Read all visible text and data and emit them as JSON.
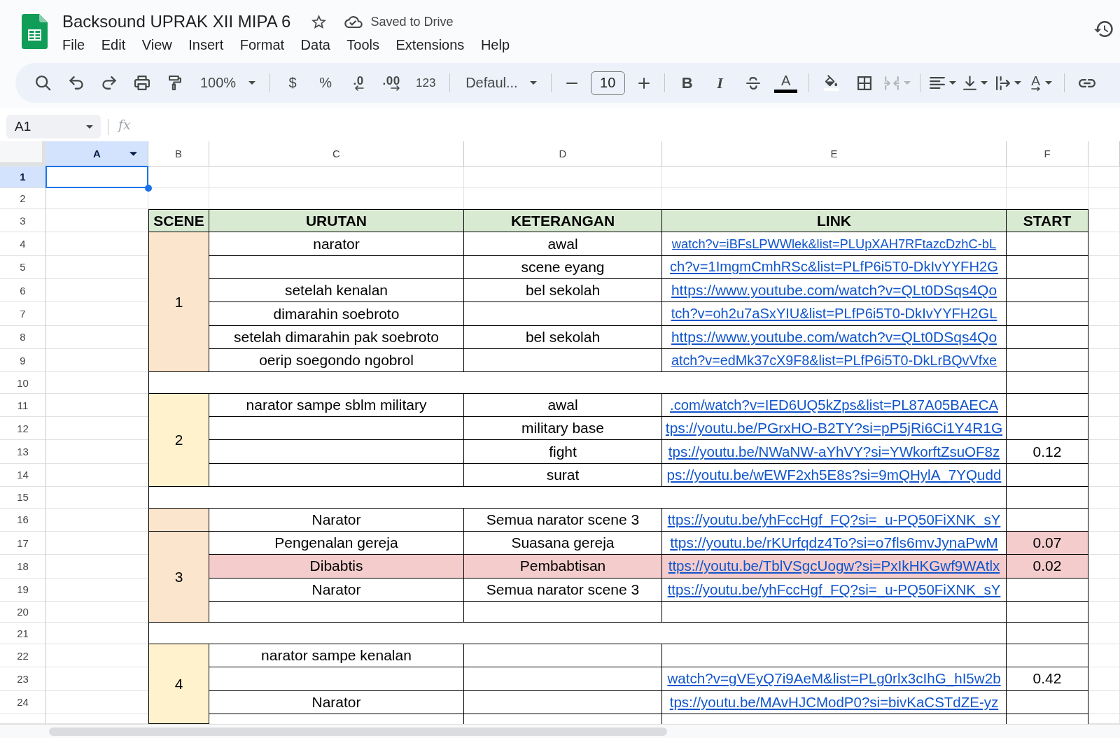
{
  "app": {
    "title": "Backsound UPRAK XII MIPA 6",
    "starred": false,
    "save_status": "Saved to Drive"
  },
  "menu": [
    "File",
    "Edit",
    "View",
    "Insert",
    "Format",
    "Data",
    "Tools",
    "Extensions",
    "Help"
  ],
  "toolbar": [
    [
      {
        "kind": "search",
        "disabled": false
      },
      {
        "kind": "undo",
        "disabled": false
      },
      {
        "kind": "redo",
        "disabled": false
      },
      {
        "kind": "print",
        "disabled": false
      },
      {
        "kind": "paintformat",
        "disabled": false
      },
      {
        "kind": "zoom",
        "label": "100%",
        "disabled": false
      }
    ],
    [
      {
        "kind": "currency",
        "label": "$",
        "disabled": false
      },
      {
        "kind": "percent",
        "label": "%",
        "disabled": false
      },
      {
        "kind": "decimalless",
        "label": ".0",
        "disabled": false
      },
      {
        "kind": "decimalmore",
        "label": ".00",
        "disabled": false
      },
      {
        "kind": "numberformat",
        "label": "123",
        "disabled": false
      }
    ],
    [
      {
        "kind": "font",
        "label": "Defaul...",
        "disabled": false
      }
    ],
    [
      {
        "kind": "sizedown",
        "disabled": false
      },
      {
        "kind": "size",
        "value": "10",
        "disabled": false
      },
      {
        "kind": "sizeup",
        "disabled": false
      }
    ],
    [
      {
        "kind": "bold",
        "label": "B",
        "disabled": false
      },
      {
        "kind": "italic",
        "label": "I",
        "disabled": false
      },
      {
        "kind": "strike",
        "disabled": false
      },
      {
        "kind": "textcolor",
        "label": "A",
        "disabled": false
      }
    ],
    [
      {
        "kind": "fill",
        "disabled": false
      },
      {
        "kind": "borders",
        "disabled": false
      },
      {
        "kind": "merge",
        "disabled": true
      }
    ],
    [
      {
        "kind": "halign",
        "disabled": false
      },
      {
        "kind": "valign",
        "disabled": false
      },
      {
        "kind": "wrap",
        "disabled": false
      },
      {
        "kind": "rotate",
        "label": "A",
        "disabled": false
      }
    ],
    [
      {
        "kind": "link",
        "disabled": false
      }
    ]
  ],
  "formula_bar": {
    "cell": "A1",
    "symbol": "fx"
  },
  "sheet": {
    "columns": [
      {
        "label": "A",
        "selected": true
      },
      {
        "label": "B",
        "selected": false
      },
      {
        "label": "C",
        "selected": false
      },
      {
        "label": "D",
        "selected": false
      },
      {
        "label": "E",
        "selected": false
      },
      {
        "label": "F",
        "selected": false
      }
    ],
    "rows": [
      {
        "label": "1",
        "selected": true
      },
      {
        "label": "2",
        "selected": false
      },
      {
        "label": "3",
        "selected": false
      },
      {
        "label": "4",
        "selected": false
      },
      {
        "label": "5",
        "selected": false
      },
      {
        "label": "6",
        "selected": false
      },
      {
        "label": "7",
        "selected": false
      },
      {
        "label": "8",
        "selected": false
      },
      {
        "label": "9",
        "selected": false
      },
      {
        "label": "10",
        "selected": false
      },
      {
        "label": "11",
        "selected": false
      },
      {
        "label": "12",
        "selected": false
      },
      {
        "label": "13",
        "selected": false
      },
      {
        "label": "14",
        "selected": false
      },
      {
        "label": "15",
        "selected": false
      },
      {
        "label": "16",
        "selected": false
      },
      {
        "label": "17",
        "selected": false
      },
      {
        "label": "18",
        "selected": false
      },
      {
        "label": "19",
        "selected": false
      },
      {
        "label": "20",
        "selected": false
      },
      {
        "label": "21",
        "selected": false
      },
      {
        "label": "22",
        "selected": false
      },
      {
        "label": "23",
        "selected": false
      },
      {
        "label": "24",
        "selected": false
      }
    ],
    "table": {
      "header": [
        "SCENE",
        "URUTAN",
        "KETERANGAN",
        "LINK",
        "START"
      ],
      "blocks": [
        {
          "kind": "group",
          "scene": "1",
          "color": "#fce5cd",
          "rows": [
            {
              "cells": [
                {
                  "text": "narator"
                },
                {
                  "text": "awal"
                },
                {
                  "text": "watch?v=iBFsLPWWlek&list=PLUpXAH7RFtazcDzhC-bL"
                },
                {}
              ]
            },
            {
              "cells": [
                {},
                {
                  "text": "scene eyang"
                },
                {
                  "text": "ch?v=1ImgmCmhRSc&list=PLfP6i5T0-DkIvYYFH2G"
                },
                {}
              ]
            },
            {
              "cells": [
                {
                  "text": "setelah kenalan"
                },
                {
                  "text": "bel sekolah"
                },
                {
                  "text": "https://www.youtube.com/watch?v=QLt0DSqs4Qo"
                },
                {}
              ]
            },
            {
              "cells": [
                {
                  "text": "dimarahin soebroto"
                },
                {},
                {
                  "text": "tch?v=oh2u7aSxYIU&list=PLfP6i5T0-DkIvYYFH2GL"
                },
                {}
              ]
            },
            {
              "cells": [
                {
                  "text": "setelah dimarahin pak soebroto"
                },
                {
                  "text": "bel sekolah"
                },
                {
                  "text": "https://www.youtube.com/watch?v=QLt0DSqs4Qo"
                },
                {}
              ]
            },
            {
              "cells": [
                {
                  "text": "oerip soegondo ngobrol"
                },
                {},
                {
                  "text": "atch?v=edMk37cX9F8&list=PLfP6i5T0-DkLrBQvVfxe"
                },
                {}
              ]
            }
          ]
        },
        {
          "kind": "spacer"
        },
        {
          "kind": "group",
          "scene": "2",
          "color": "#fff2cc",
          "rows": [
            {
              "cells": [
                {
                  "text": "narator sampe sblm military"
                },
                {
                  "text": "awal"
                },
                {
                  "text": ".com/watch?v=IED6UQ5kZps&list=PL87A05BAECA"
                },
                {}
              ]
            },
            {
              "cells": [
                {},
                {
                  "text": "military base"
                },
                {
                  "text": "tps://youtu.be/PGrxHO-B2TY?si=pP5jRi6Ci1Y4R1G"
                },
                {}
              ]
            },
            {
              "cells": [
                {},
                {
                  "text": "fight"
                },
                {
                  "text": "tps://youtu.be/NWaNW-aYhVY?si=YWkorftZsuOF8z"
                },
                {
                  "text": "0.12"
                }
              ]
            },
            {
              "cells": [
                {},
                {
                  "text": "surat"
                },
                {
                  "text": "ps://youtu.be/wEWF2xh5E8s?si=9mQHylA_7YQudd"
                },
                {}
              ]
            }
          ]
        },
        {
          "kind": "spacer"
        },
        {
          "kind": "group",
          "color": "#fce5cd",
          "rows": [
            {
              "cells": [
                {
                  "text": "Narator"
                },
                {
                  "text": "Semua narator scene 3"
                },
                {
                  "text": "ttps://youtu.be/yhFccHgf_FQ?si=_u-PQ50FiXNK_sY"
                },
                {}
              ]
            }
          ]
        },
        {
          "kind": "group",
          "scene": "3",
          "color": "#fce5cd",
          "rows": [
            {
              "cells": [
                {
                  "text": "Pengenalan gereja"
                },
                {
                  "text": "Suasana gereja"
                },
                {
                  "text": "ttps://youtu.be/rKUrfqdz4To?si=o7fls6mvJynaPwM"
                },
                {
                  "text": "0.07",
                  "color": "#f4cccc"
                }
              ]
            },
            {
              "cells": [
                {
                  "text": "Dibabtis",
                  "color": "#f4cccc"
                },
                {
                  "text": "Pembabtisan",
                  "color": "#f4cccc"
                },
                {
                  "text": "ttps://youtu.be/TblVSgcUogw?si=PxIkHKGwf9WAtlx",
                  "color": "#f4cccc"
                },
                {
                  "text": "0.02",
                  "color": "#f4cccc"
                }
              ]
            },
            {
              "cells": [
                {
                  "text": "Narator"
                },
                {
                  "text": "Semua narator scene 3"
                },
                {
                  "text": "ttps://youtu.be/yhFccHgf_FQ?si=_u-PQ50FiXNK_sY"
                },
                {}
              ]
            },
            {
              "cells": [
                {},
                {},
                {},
                {}
              ]
            }
          ]
        },
        {
          "kind": "spacer"
        },
        {
          "kind": "group",
          "scene": "4",
          "color": "#fff2cc",
          "rows": [
            {
              "cells": [
                {
                  "text": "narator sampe kenalan"
                },
                {},
                {},
                {}
              ]
            },
            {
              "cells": [
                {},
                {},
                {
                  "text": "watch?v=gVEyQ7i9AeM&list=PLg0rlx3cIhG_hI5w2b"
                },
                {
                  "text": "0.42"
                }
              ]
            },
            {
              "cells": [
                {
                  "text": "Narator"
                },
                {},
                {
                  "text": "tps://youtu.be/MAvHJCModP0?si=bivKaCSTdZE-yz"
                },
                {}
              ]
            }
          ]
        }
      ]
    }
  }
}
